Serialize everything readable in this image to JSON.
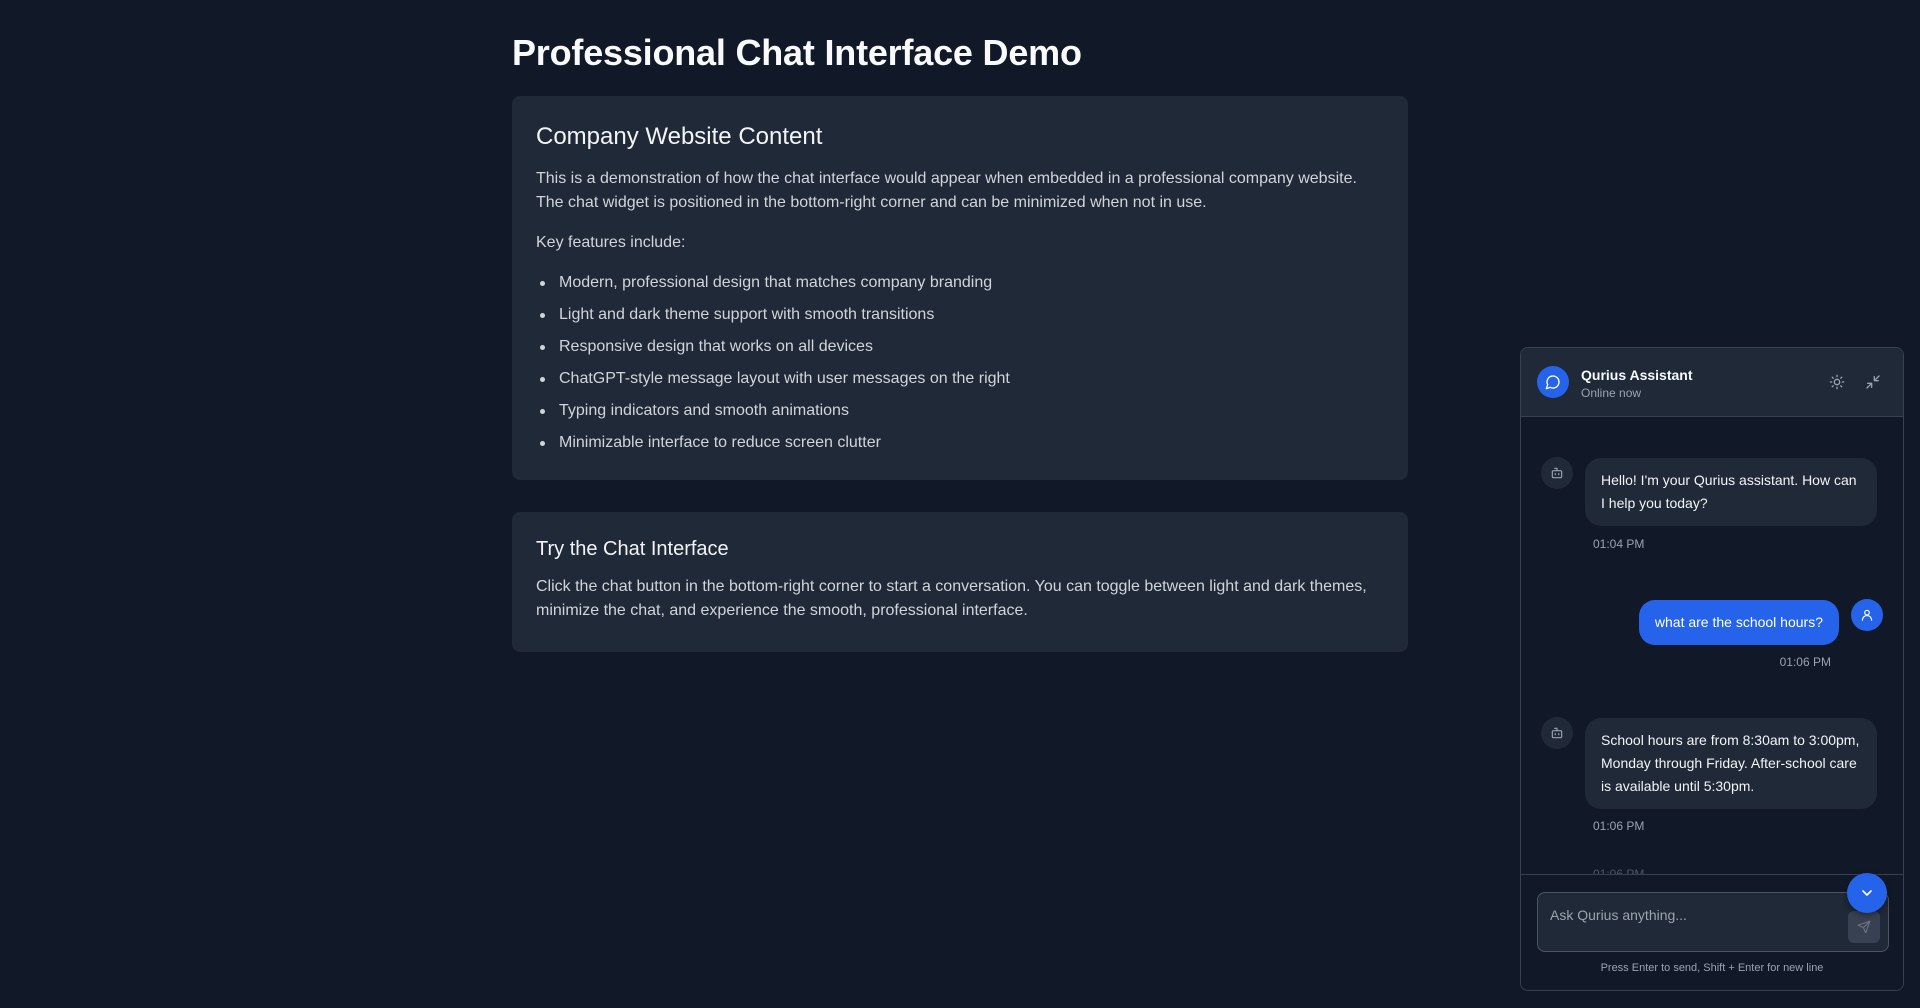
{
  "page": {
    "title": "Professional Chat Interface Demo"
  },
  "card1": {
    "heading": "Company Website Content",
    "intro": "This is a demonstration of how the chat interface would appear when embedded in a professional company website. The chat widget is positioned in the bottom-right corner and can be minimized when not in use.",
    "features_label": "Key features include:",
    "features": [
      "Modern, professional design that matches company branding",
      "Light and dark theme support with smooth transitions",
      "Responsive design that works on all devices",
      "ChatGPT-style message layout with user messages on the right",
      "Typing indicators and smooth animations",
      "Minimizable interface to reduce screen clutter"
    ]
  },
  "card2": {
    "heading": "Try the Chat Interface",
    "body": "Click the chat button in the bottom-right corner to start a conversation. You can toggle between light and dark themes, minimize the chat, and experience the smooth, professional interface."
  },
  "chat": {
    "name": "Qurius Assistant",
    "status": "Online now",
    "icons": {
      "avatar": "message-circle-icon",
      "theme": "sun-icon",
      "minimize": "minimize-icon",
      "bot": "bot-icon",
      "user": "user-icon",
      "scroll": "chevron-down-icon",
      "send": "send-icon"
    },
    "messages": [
      {
        "role": "bot",
        "text": "Hello! I'm your Qurius assistant. How can I help you today?",
        "time": "01:04 PM"
      },
      {
        "role": "user",
        "text": "what are the school hours?",
        "time": "01:06 PM"
      },
      {
        "role": "bot",
        "text": "School hours are from 8:30am to 3:00pm, Monday through Friday. After-school care is available until 5:30pm.",
        "time": "01:06 PM"
      }
    ],
    "partial_time": "01:06 PM",
    "input_placeholder": "Ask Qurius anything...",
    "hint": "Press Enter to send, Shift + Enter for new line",
    "colors": {
      "accent": "#2563eb",
      "background": "#111827",
      "surface": "#1f2937"
    }
  }
}
